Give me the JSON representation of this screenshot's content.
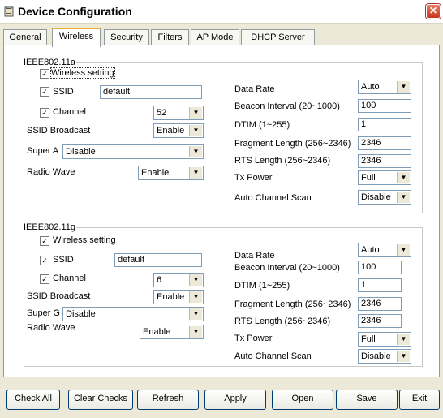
{
  "window": {
    "title": "Device Configuration",
    "close_glyph": "✕"
  },
  "tabs": [
    "General",
    "Wireless",
    "Security",
    "Filters",
    "AP Mode",
    "DHCP Server"
  ],
  "active_tab": "Wireless",
  "a": {
    "legend": "IEEE802.11a",
    "wireless_setting": "Wireless setting",
    "ssid_label": "SSID",
    "ssid_value": "default",
    "channel_label": "Channel",
    "channel_value": "52",
    "ssid_broadcast_label": "SSID Broadcast",
    "ssid_broadcast_value": "Enable",
    "super_label": "Super A",
    "super_value": "Disable",
    "radio_wave_label": "Radio Wave",
    "radio_wave_value": "Enable",
    "data_rate_label": "Data Rate",
    "data_rate_value": "Auto",
    "beacon_label": "Beacon Interval (20~1000)",
    "beacon_value": "100",
    "dtim_label": "DTIM (1~255)",
    "dtim_value": "1",
    "frag_label": "Fragment Length (256~2346)",
    "frag_value": "2346",
    "rts_label": "RTS Length (256~2346)",
    "rts_value": "2346",
    "tx_label": "Tx Power",
    "tx_value": "Full",
    "acs_label": "Auto Channel Scan",
    "acs_value": "Disable"
  },
  "g": {
    "legend": "IEEE802.11g",
    "wireless_setting": "Wireless setting",
    "ssid_label": "SSID",
    "ssid_value": "default",
    "channel_label": "Channel",
    "channel_value": "6",
    "ssid_broadcast_label": "SSID Broadcast",
    "ssid_broadcast_value": "Enable",
    "super_label": "Super G",
    "super_value": "Disable",
    "radio_wave_label": "Radio Wave",
    "radio_wave_value": "Enable",
    "data_rate_label": "Data Rate",
    "data_rate_value": "Auto",
    "beacon_label": "Beacon Interval (20~1000)",
    "beacon_value": "100",
    "dtim_label": "DTIM (1~255)",
    "dtim_value": "1",
    "frag_label": "Fragment Length (256~2346)",
    "frag_value": "2346",
    "rts_label": "RTS Length (256~2346)",
    "rts_value": "2346",
    "tx_label": "Tx Power",
    "tx_value": "Full",
    "acs_label": "Auto Channel Scan",
    "acs_value": "Disable"
  },
  "checkbox_mark": "✓",
  "dropdown_glyph": "▼",
  "buttons": {
    "check_all": "Check All",
    "clear_checks": "Clear Checks",
    "refresh": "Refresh",
    "apply": "Apply",
    "open": "Open",
    "save": "Save",
    "exit": "Exit"
  }
}
